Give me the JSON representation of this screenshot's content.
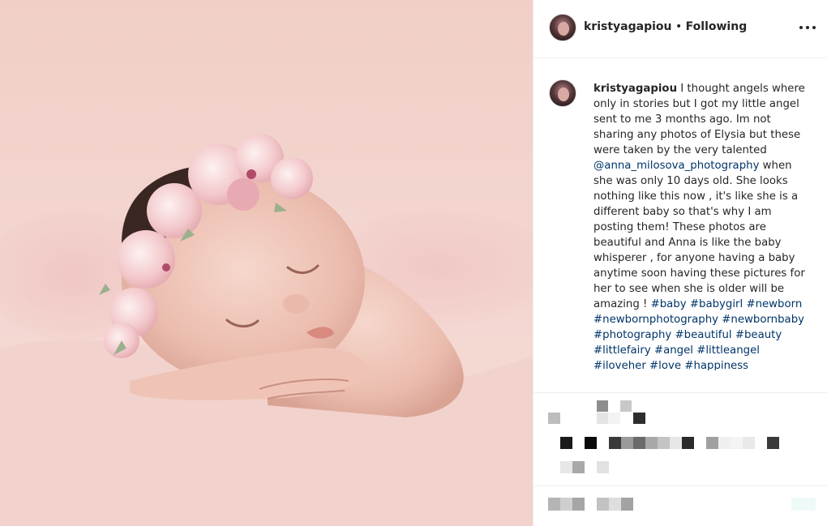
{
  "post": {
    "author": "kristyagapiou",
    "separator": " • ",
    "follow_status": "Following"
  },
  "caption": {
    "username": "kristyagapiou",
    "text_1": " I thought angels where only in stories but I got my little angel sent to me 3 months ago. Im not sharing any photos of Elysia but these were taken by the very talented ",
    "mention": "@anna_milosova_photography",
    "text_2": " when she was only 10 days old. She looks nothing like this now , it's like she is a different baby so that's why I am posting them! These photos are beautiful and Anna is like the baby whisperer , for anyone having a baby anytime soon having these pictures for her to see when she is older will be amazing ! ",
    "hashtags": [
      "#baby",
      "#babygirl",
      "#newborn",
      "#newbornphotography",
      "#newbornbaby",
      "#photography",
      "#beautiful",
      "#beauty",
      "#littlefairy",
      "#angel",
      "#littleangel",
      "#iloveher",
      "#love",
      "#happiness"
    ]
  },
  "icons": {
    "more": "more-options-icon"
  },
  "colors": {
    "link": "#003569",
    "text": "#262626",
    "border": "#efefef"
  }
}
